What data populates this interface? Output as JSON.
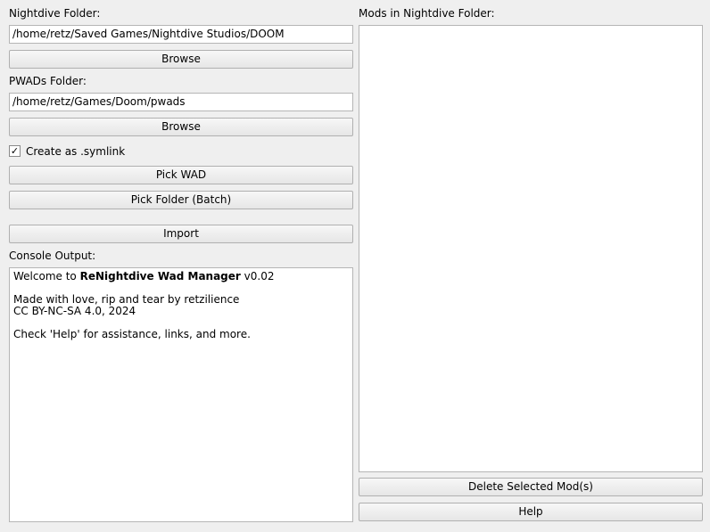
{
  "left": {
    "nightdive_label": "Nightdive Folder:",
    "nightdive_path": "/home/retz/Saved Games/Nightdive Studios/DOOM",
    "browse_label": "Browse",
    "pwads_label": "PWADs Folder:",
    "pwads_path": "/home/retz/Games/Doom/pwads",
    "browse2_label": "Browse",
    "symlink": {
      "label": "Create as .symlink",
      "checked": true,
      "mark": "✓"
    },
    "pick_wad_label": "Pick WAD",
    "pick_folder_label": "Pick Folder (Batch)",
    "import_label": "Import",
    "console_label": "Console Output:",
    "console": {
      "welcome_prefix": "Welcome to ",
      "app_name": "ReNightdive Wad Manager",
      "version": " v0.02",
      "made_with": "Made with love, rip and tear by retzilience",
      "license": "CC BY-NC-SA 4.0, 2024",
      "help_hint": "Check 'Help' for assistance, links, and more."
    }
  },
  "right": {
    "mods_label": "Mods in Nightdive Folder:",
    "mods": [],
    "delete_label": "Delete Selected Mod(s)",
    "help_label": "Help"
  }
}
